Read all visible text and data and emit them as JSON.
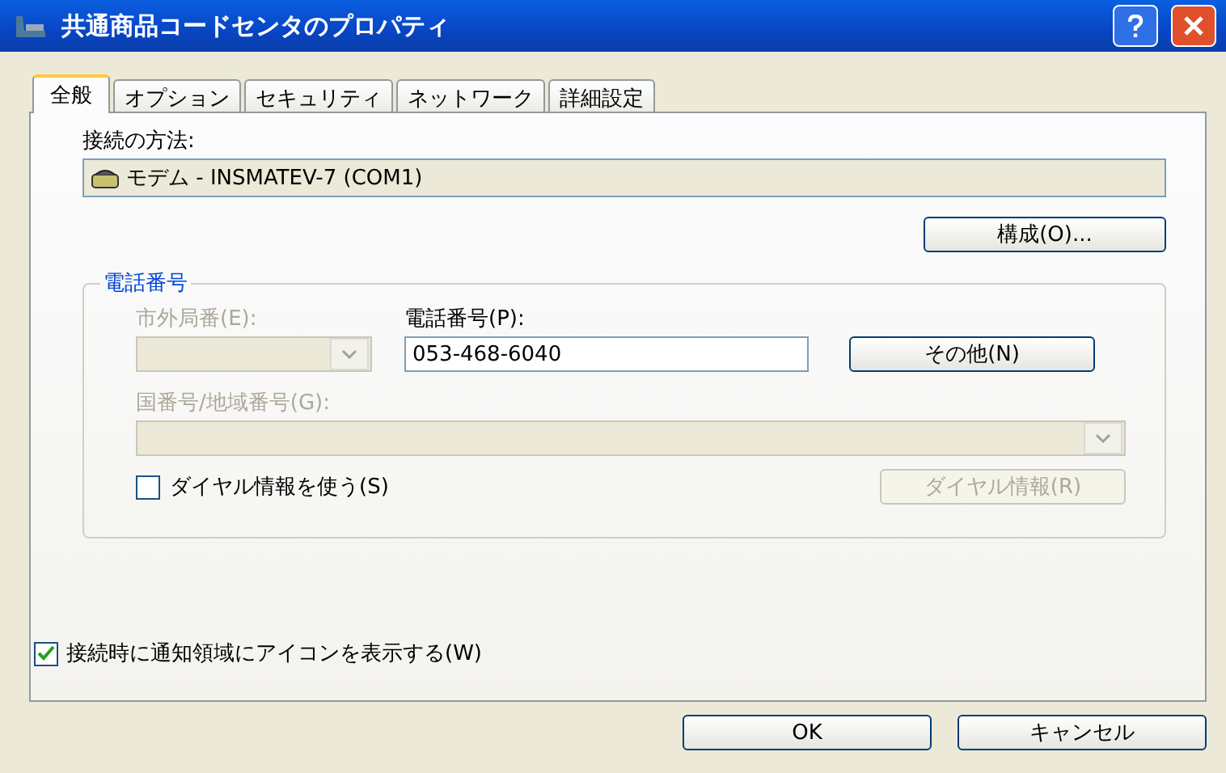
{
  "window": {
    "title": "共通商品コードセンタのプロパティ"
  },
  "tabs": [
    {
      "label": "全般",
      "selected": true
    },
    {
      "label": "オプション",
      "selected": false
    },
    {
      "label": "セキュリティ",
      "selected": false
    },
    {
      "label": "ネットワーク",
      "selected": false
    },
    {
      "label": "詳細設定",
      "selected": false
    }
  ],
  "connect_using": {
    "label": "接続の方法:",
    "device": "モデム - INSMATEV-7 (COM1)",
    "configure_button": "構成(O)..."
  },
  "phone_group": {
    "title": "電話番号",
    "area_code": {
      "label": "市外局番(E):",
      "disabled": true
    },
    "phone_number": {
      "label": "電話番号(P):",
      "value": "053-468-6040"
    },
    "other_button": {
      "label": "その他(N)",
      "disabled": false
    },
    "country_code": {
      "label": "国番号/地域番号(G):",
      "disabled": true
    },
    "use_dialing_rules": {
      "label": "ダイヤル情報を使う(S)",
      "checked": false
    },
    "dialing_rules_button": {
      "label": "ダイヤル情報(R)",
      "disabled": true
    }
  },
  "show_icon": {
    "label": "接続時に通知領域にアイコンを表示する(W)",
    "checked": true
  },
  "buttons": [
    {
      "label": "OK"
    },
    {
      "label": "キャンセル"
    }
  ]
}
